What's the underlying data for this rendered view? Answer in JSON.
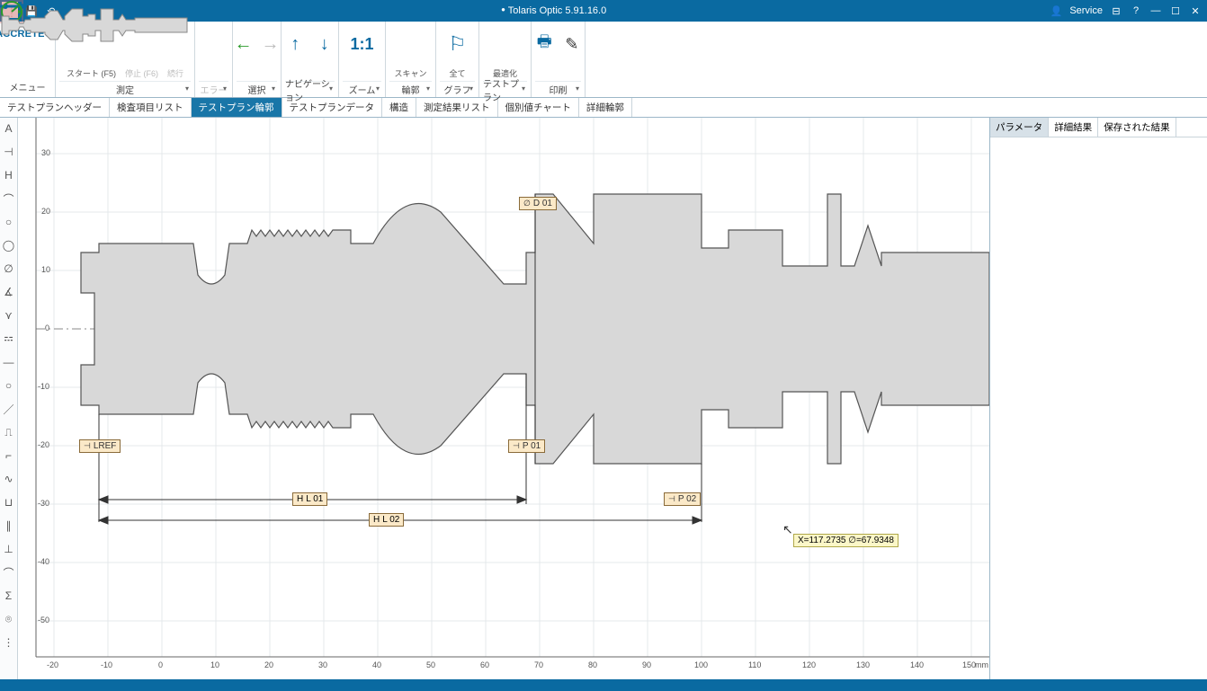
{
  "app": {
    "title": "Tolaris Optic 5.91.16.0",
    "user_label": "Service"
  },
  "ribbon": {
    "brand": "ACCRETECH",
    "menu": "メニュー",
    "groups": {
      "measure": {
        "start": "スタート (F5)",
        "stop": "停止 (F6)",
        "resume": "続行",
        "label": "測定"
      },
      "error": {
        "label": "エラー"
      },
      "select": {
        "label": "選択"
      },
      "navigation": {
        "label": "ナビゲーション"
      },
      "zoom": {
        "ratio": "1:1",
        "label": "ズーム"
      },
      "contour": {
        "scan": "スキャン",
        "label": "輪郭"
      },
      "graph": {
        "all": "全て",
        "label": "グラフ"
      },
      "testplan": {
        "optimize": "最適化",
        "label": "テストプラン"
      },
      "print": {
        "label": "印刷"
      }
    }
  },
  "tabs": {
    "main": [
      "テストプランヘッダー",
      "検査項目リスト",
      "テストプラン輪郭",
      "テストプランデータ",
      "構造",
      "測定結果リスト",
      "個別値チャート",
      "詳細輪郭"
    ],
    "active_index": 2,
    "right": [
      "パラメータ",
      "詳細結果",
      "保存された結果"
    ],
    "right_active_index": 0
  },
  "canvas": {
    "y_ticks": [
      "30",
      "20",
      "10",
      "0",
      "-10",
      "-20",
      "-30",
      "-40",
      "-50"
    ],
    "x_ticks": [
      "-20",
      "-10",
      "0",
      "10",
      "20",
      "30",
      "40",
      "50",
      "60",
      "70",
      "80",
      "90",
      "100",
      "110",
      "120",
      "130",
      "140",
      "150"
    ],
    "x_unit": "mm",
    "callouts": {
      "d01": "D 01",
      "lref": "LREF",
      "p01": "P 01",
      "p02": "P 02",
      "l01": "L 01",
      "l02": "L 02"
    },
    "cursor_readout": "X=117.2735 ∅=67.9348"
  },
  "chart_data": {
    "type": "line",
    "title": "",
    "xlabel": "mm",
    "ylabel": "",
    "xlim": [
      -20,
      155
    ],
    "ylim": [
      -55,
      35
    ],
    "series": [
      {
        "name": "upper_profile",
        "x": [
          -15,
          -12,
          -12,
          -10,
          -10,
          12,
          14,
          18,
          20,
          25,
          28,
          40,
          40,
          46,
          53,
          60,
          60,
          65,
          65,
          70,
          78,
          88,
          88,
          92,
          92,
          98,
          98,
          103,
          103,
          113,
          113,
          118,
          122,
          126,
          135,
          135,
          155
        ],
        "y": [
          6,
          6,
          15,
          15,
          13,
          13,
          8,
          8,
          13,
          13,
          14.5,
          14.5,
          17,
          23,
          23,
          11,
          8,
          8,
          15,
          23,
          23,
          23,
          14,
          14,
          17,
          17,
          11,
          11,
          23,
          23,
          11,
          11,
          18,
          11,
          11,
          13,
          13
        ]
      },
      {
        "name": "lower_profile",
        "x": [
          -15,
          -12,
          -12,
          -10,
          -10,
          12,
          14,
          18,
          20,
          25,
          28,
          40,
          40,
          46,
          53,
          60,
          60,
          62,
          62,
          70,
          78,
          88,
          88,
          92,
          92,
          98,
          98,
          103,
          103,
          113,
          113,
          118,
          122,
          126,
          135,
          135,
          155
        ],
        "y": [
          -6,
          -6,
          -15,
          -15,
          -13,
          -13,
          -8,
          -8,
          -13,
          -13,
          -14.5,
          -14.5,
          -17,
          -23,
          -23,
          -11,
          -8,
          -8,
          -15,
          -23,
          -23,
          -23,
          -14,
          -14,
          -17,
          -17,
          -11,
          -11,
          -23,
          -23,
          -11,
          -11,
          -18,
          -11,
          -11,
          -13,
          -13
        ]
      }
    ],
    "annotations": [
      {
        "label": "D 01",
        "x": 63,
        "y": 20,
        "type": "diameter"
      },
      {
        "label": "LREF",
        "x": -10,
        "y": -18,
        "type": "reference"
      },
      {
        "label": "P 01",
        "x": 60,
        "y": -18,
        "type": "point"
      },
      {
        "label": "P 02",
        "x": 98,
        "y": -28,
        "type": "point"
      },
      {
        "label": "L 01",
        "from_x": -10,
        "to_x": 60,
        "y": -28,
        "type": "length"
      },
      {
        "label": "L 02",
        "from_x": -10,
        "to_x": 98,
        "y": -34,
        "type": "length"
      }
    ]
  }
}
